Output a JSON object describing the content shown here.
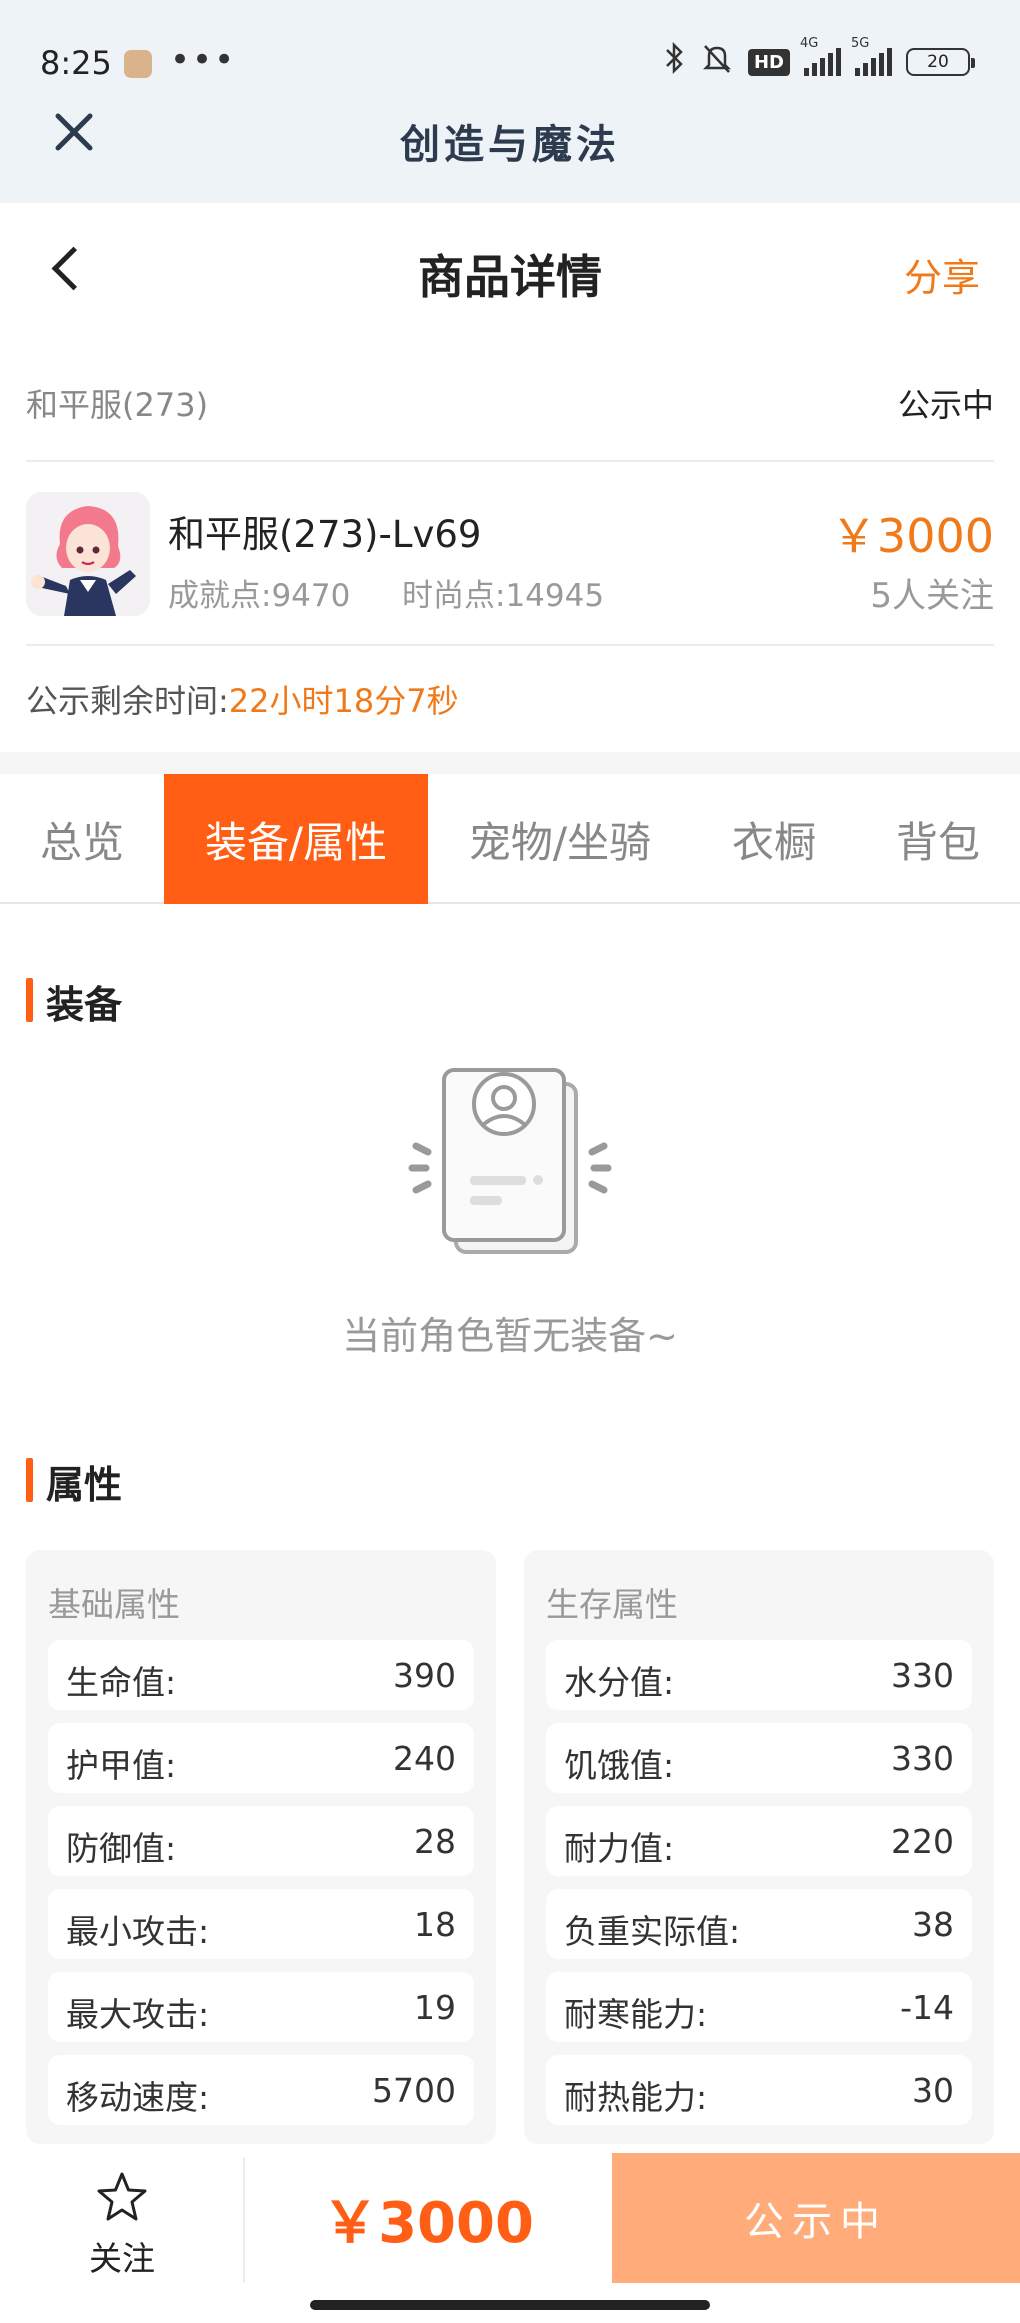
{
  "status_bar": {
    "time": "8:25",
    "more": "•••",
    "hd": "HD",
    "net1": "4G",
    "net2": "5G",
    "battery": "20"
  },
  "webview": {
    "title": "创造与魔法"
  },
  "header": {
    "title": "商品详情",
    "share": "分享"
  },
  "server": {
    "name": "和平服(273)",
    "status": "公示中"
  },
  "product": {
    "name": "和平服(273)-Lv69",
    "achievement": "成就点:9470",
    "fashion": "时尚点:14945",
    "price": "￥3000",
    "followers": "5人关注"
  },
  "countdown": {
    "label": "公示剩余时间:",
    "value": "22小时18分7秒"
  },
  "tabs": [
    "总览",
    "装备/属性",
    "宠物/坐骑",
    "衣橱",
    "背包"
  ],
  "active_tab": "装备/属性",
  "equipment": {
    "title": "装备",
    "empty_text": "当前角色暂无装备~"
  },
  "attributes": {
    "title": "属性",
    "basic": {
      "title": "基础属性",
      "rows": [
        {
          "k": "生命值:",
          "v": "390"
        },
        {
          "k": "护甲值:",
          "v": "240"
        },
        {
          "k": "防御值:",
          "v": "28"
        },
        {
          "k": "最小攻击:",
          "v": "18"
        },
        {
          "k": "最大攻击:",
          "v": "19"
        },
        {
          "k": "移动速度:",
          "v": "5700"
        }
      ]
    },
    "survival": {
      "title": "生存属性",
      "rows": [
        {
          "k": "水分值:",
          "v": "330"
        },
        {
          "k": "饥饿值:",
          "v": "330"
        },
        {
          "k": "耐力值:",
          "v": "220"
        },
        {
          "k": "负重实际值:",
          "v": "38"
        },
        {
          "k": "耐寒能力:",
          "v": "-14"
        },
        {
          "k": "耐热能力:",
          "v": "30"
        }
      ]
    }
  },
  "bottom": {
    "follow": "关注",
    "price": "￥3000",
    "status": "公示中"
  },
  "colors": {
    "accent": "#ff5e14",
    "price": "#f07a1a",
    "disabled_button": "#ffac7a"
  },
  "icons": {
    "close": "close-icon",
    "back": "back-arrow-icon",
    "star": "star-icon",
    "empty": "empty-profile-icon"
  }
}
